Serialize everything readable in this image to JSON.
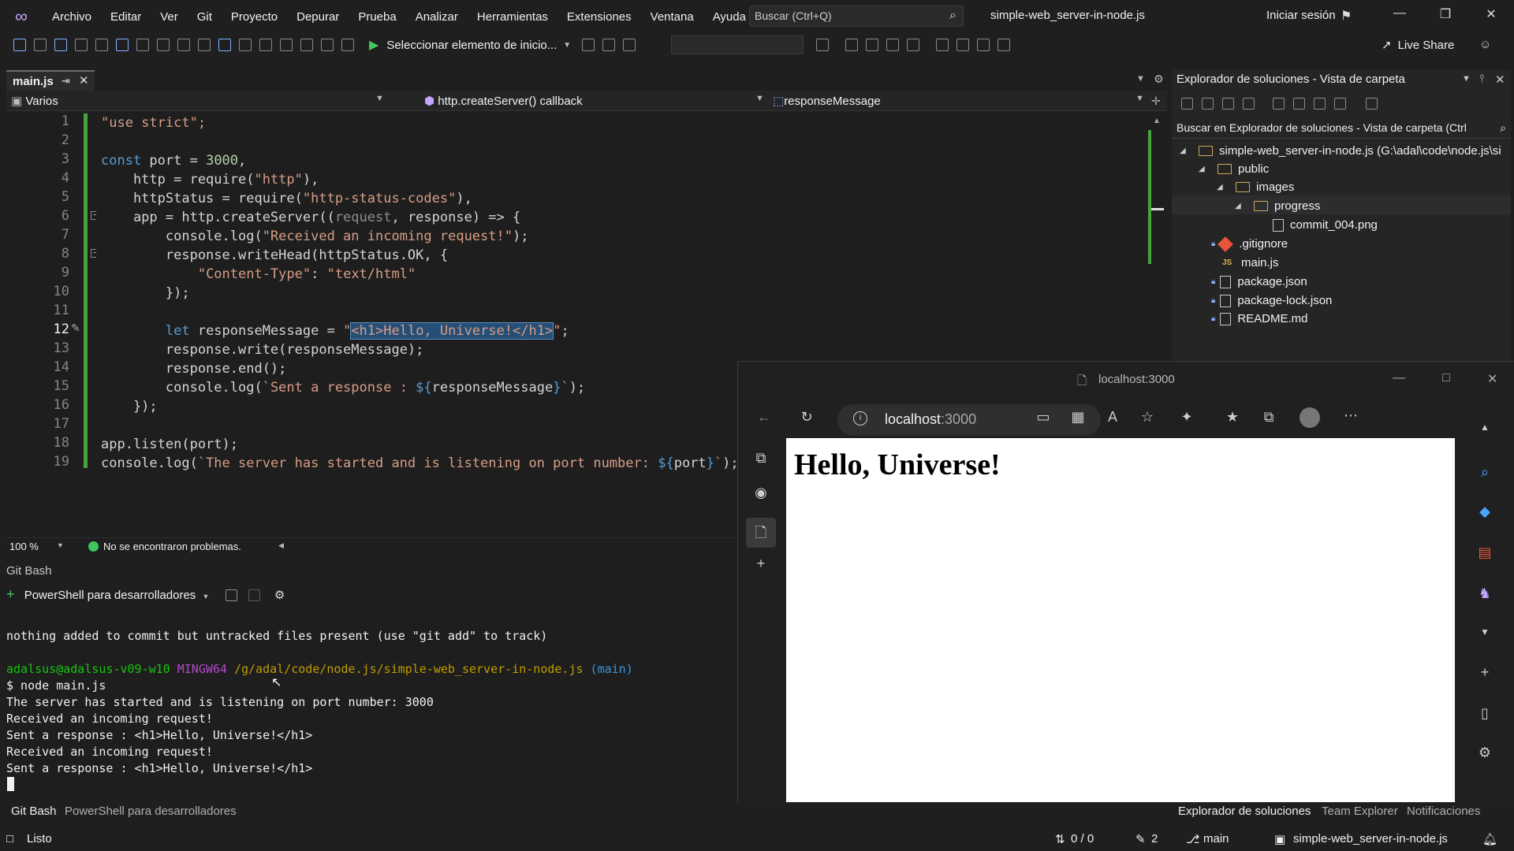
{
  "menubar": {
    "items": [
      "Archivo",
      "Editar",
      "Ver",
      "Git",
      "Proyecto",
      "Depurar",
      "Prueba",
      "Analizar",
      "Herramientas",
      "Extensiones",
      "Ventana",
      "Ayuda"
    ],
    "search_placeholder": "Buscar (Ctrl+Q)",
    "solution_title": "simple-web_server-in-node.js",
    "signin": "Iniciar sesión"
  },
  "toolbar": {
    "start_label": "Seleccionar elemento de inicio...",
    "live_share": "Live Share"
  },
  "editor": {
    "tab_label": "main.js",
    "nav_scope": "Varios",
    "nav_member": "http.createServer() callback",
    "nav_symbol": "responseMessage",
    "zoom": "100 %",
    "problems": "No se encontraron problemas.",
    "line_numbers": [
      "1",
      "2",
      "3",
      "4",
      "5",
      "6",
      "7",
      "8",
      "9",
      "10",
      "11",
      "12",
      "13",
      "14",
      "15",
      "16",
      "17",
      "18",
      "19"
    ],
    "code": {
      "l1": "\"use strict\";",
      "l3a": "const",
      "l3b": " port = ",
      "l3c": "3000",
      "l3d": ",",
      "l4a": "    http = require(",
      "l4b": "\"http\"",
      "l4c": "),",
      "l5a": "    httpStatus = require(",
      "l5b": "\"http-status-codes\"",
      "l5c": "),",
      "l6a": "    app = http.createServer((",
      "l6b": "request",
      "l6c": ", response) => {",
      "l7a": "        console.log(",
      "l7b": "\"Received an incoming request!\"",
      "l7c": ");",
      "l8": "        response.writeHead(httpStatus.OK, {",
      "l9a": "            ",
      "l9b": "\"Content-Type\"",
      "l9c": ": ",
      "l9d": "\"text/html\"",
      "l10": "        });",
      "l12a": "        let",
      "l12b": " responseMessage = ",
      "l12c": "\"",
      "l12d": "<h1>Hello, Universe!</h1>",
      "l12e": "\"",
      "l12f": ";",
      "l13": "        response.write(responseMessage);",
      "l14": "        response.end();",
      "l15a": "        console.log(",
      "l15b": "`Sent a response : ",
      "l15c": "${",
      "l15d": "responseMessage",
      "l15e": "}",
      "l15f": "`",
      "l15g": ");",
      "l16": "    });",
      "l18": "app.listen(port);",
      "l19a": "console.log(",
      "l19b": "`The server has started and is listening on port number: ",
      "l19c": "${",
      "l19d": "port",
      "l19e": "}",
      "l19f": "`",
      "l19g": ");"
    }
  },
  "solution_explorer": {
    "title": "Explorador de soluciones - Vista de carpeta",
    "search_placeholder": "Buscar en Explorador de soluciones - Vista de carpeta (Ctrl",
    "tree": {
      "root": "simple-web_server-in-node.js (G:\\adal\\code\\node.js\\si",
      "public": "public",
      "images": "images",
      "progress": "progress",
      "commit": "commit_004.png",
      "gitignore": ".gitignore",
      "mainjs": "main.js",
      "package": "package.json",
      "packagelock": "package-lock.json",
      "readme": "README.md"
    }
  },
  "terminal": {
    "header": "Git Bash",
    "shell_label": "PowerShell para desarrolladores",
    "lines": {
      "t1": "nothing added to commit but untracked files present (use \"git add\" to track)",
      "t3a": "adalsus@adalsus-v09-w10",
      "t3b": "MINGW64",
      "t3c": "/g/adal/code/node.js/simple-web_server-in-node.js",
      "t3d": "(main)",
      "t4": "$ node main.js",
      "t5": "The server has started and is listening on port number: 3000",
      "t6": "Received an incoming request!",
      "t7": "Sent a response : <h1>Hello, Universe!</h1>",
      "t8": "Received an incoming request!",
      "t9": "Sent a response : <h1>Hello, Universe!</h1>"
    },
    "tab_gitbash": "Git Bash",
    "tab_powershell": "PowerShell para desarrolladores"
  },
  "right_tabs": [
    "Explorador de soluciones",
    "Team Explorer",
    "Notificaciones"
  ],
  "statusbar": {
    "ready": "Listo",
    "sync": "0 / 0",
    "changes": "2",
    "branch": "main",
    "repo": "simple-web_server-in-node.js"
  },
  "browser": {
    "title": "localhost:3000",
    "address_host": "localhost",
    "address_port": ":3000",
    "heading": "Hello, Universe!"
  }
}
